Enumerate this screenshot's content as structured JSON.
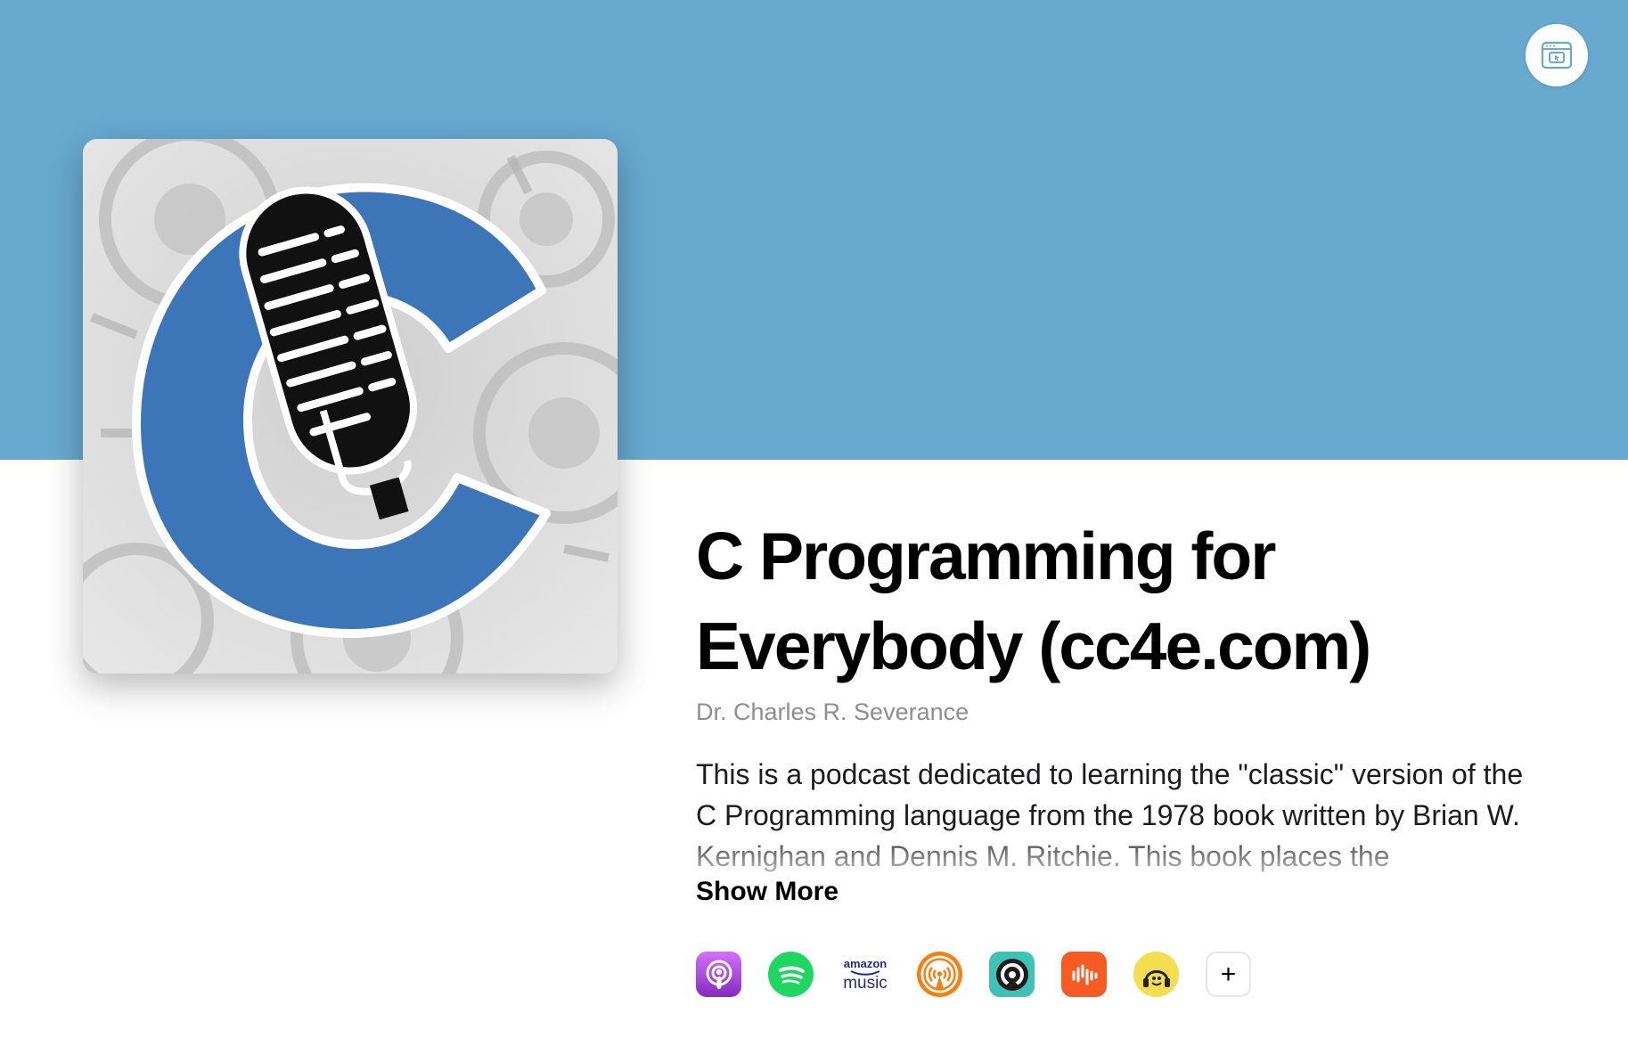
{
  "colors": {
    "hero_background": "#67a9cf",
    "cover_c_blue": "#3d75b9",
    "author_gray": "#8e8e93"
  },
  "header": {
    "corner_button_icon": "window-pointer-icon"
  },
  "podcast": {
    "cover_icon": "microphone-c-logo",
    "title": "C Programming for Everybody (cc4e.com)",
    "author": "Dr. Charles R. Severance",
    "description": "This is a podcast dedicated to learning the \"classic\" version of the C Programming language from the 1978 book written by Brian W. Kernighan and Dennis M. Ritchie. This book places the",
    "show_more_label": "Show More"
  },
  "platforms": {
    "amazon_line1": "amazon",
    "amazon_line2": "music",
    "more_label": "+",
    "items": [
      {
        "name": "apple-podcasts",
        "icon": "apple-podcasts-icon"
      },
      {
        "name": "spotify",
        "icon": "spotify-icon"
      },
      {
        "name": "amazon-music",
        "icon": "amazon-music-icon"
      },
      {
        "name": "overcast",
        "icon": "overcast-icon"
      },
      {
        "name": "pocket-casts-alt",
        "icon": "castro-icon"
      },
      {
        "name": "castbox",
        "icon": "castbox-icon"
      },
      {
        "name": "podcast-addict",
        "icon": "podcast-addict-icon"
      }
    ]
  }
}
